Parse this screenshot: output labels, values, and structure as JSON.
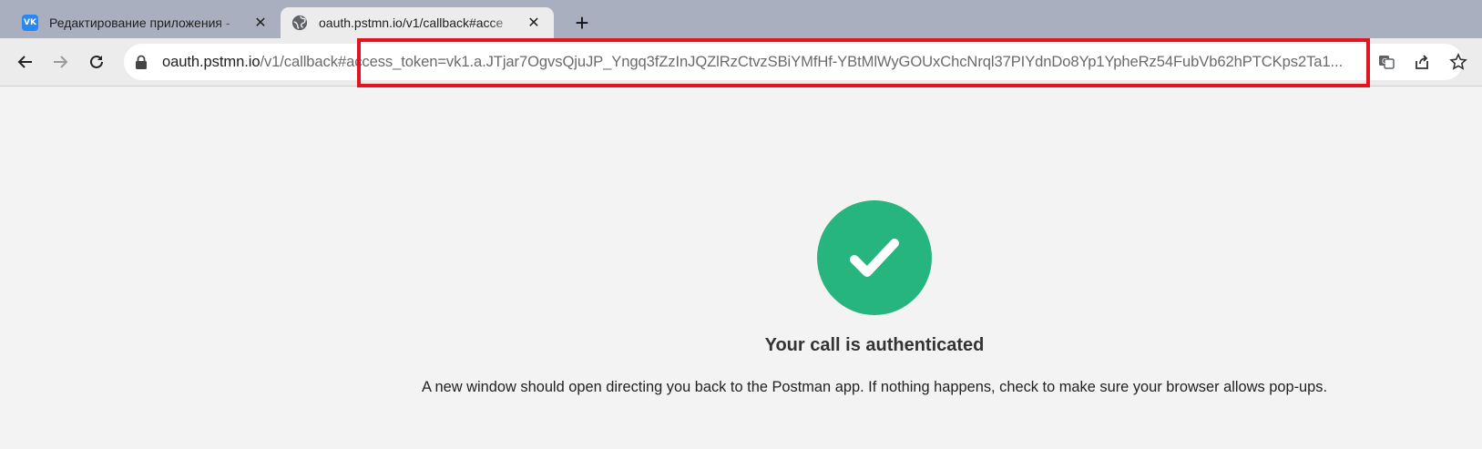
{
  "tabs": [
    {
      "title": "Редактирование приложения -",
      "favicon": "vk-icon",
      "favicon_text": "VK",
      "active": false
    },
    {
      "title": "oauth.pstmn.io/v1/callback#acce",
      "favicon": "globe-icon",
      "active": true
    }
  ],
  "tab_close_symbol": "✕",
  "new_tab_symbol": "+",
  "address_bar": {
    "url_host": "oauth.pstmn.io",
    "url_path": "/v1/callback#access_token=vk1.a.JTjar7OgvsQjuJP_Yngq3fZzInJQZlRzCtvzSBiYMfHf-YBtMlWyGOUxChcNrql37PIYdnDo8Yp1YpheRz54FubVb62hPTCKps2Ta1..."
  },
  "page": {
    "heading": "Your call is authenticated",
    "message": "A new window should open directing you back to the Postman app. If nothing happens, check to make sure your browser allows pop-ups."
  },
  "colors": {
    "success_green": "#26b47f",
    "highlight_red": "#e3141f",
    "vk_blue": "#2787f5"
  }
}
